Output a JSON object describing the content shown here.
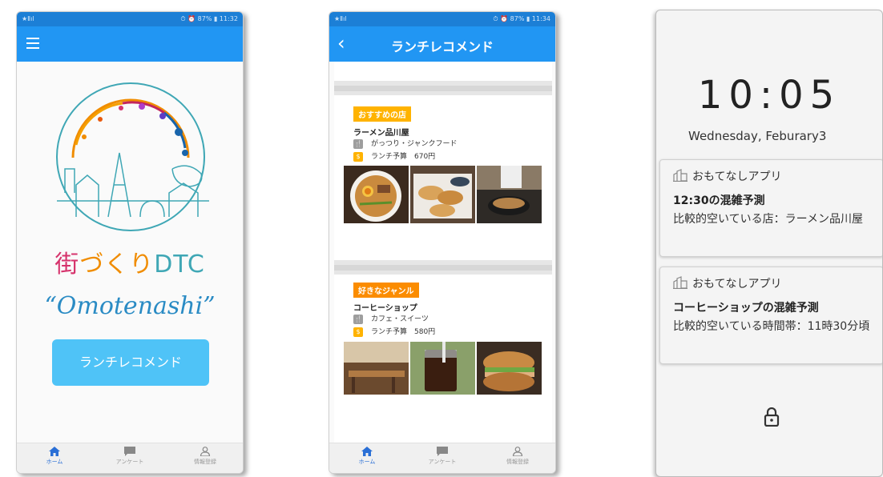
{
  "phone1": {
    "status_left": "★Ⅱıl",
    "status_right": "⏱ ⏰ 87% ▮ 11:32",
    "brand": {
      "part1": "街",
      "part2": "づくり",
      "part3": "DTC"
    },
    "tagline": "“Omotenashi”",
    "main_button": "ランチレコメンド",
    "nav": [
      {
        "label": "ホーム",
        "icon": "home-icon"
      },
      {
        "label": "アンケート",
        "icon": "chat-icon"
      },
      {
        "label": "情報登録",
        "icon": "person-icon"
      }
    ]
  },
  "phone2": {
    "status_left": "★Ⅱıl",
    "status_right": "⏱ ⏰ 87% ▮ 11:34",
    "title": "ランチレコメンド",
    "cards": [
      {
        "badge": "おすすめの店",
        "name": "ラーメン品川屋",
        "genre": "がっつり・ジャンクフード",
        "budget": "ランチ予算　670円"
      },
      {
        "badge": "好きなジャンル",
        "name": "コーヒーショップ",
        "genre": "カフェ・スイーツ",
        "budget": "ランチ予算　580円"
      }
    ],
    "nav": [
      {
        "label": "ホーム"
      },
      {
        "label": "アンケート"
      },
      {
        "label": "情報登録"
      }
    ]
  },
  "phone3": {
    "time": "10:05",
    "date": "Wednesday, Feburary3",
    "notifications": [
      {
        "app": "おもてなしアプリ",
        "title": "12:30の混雑予測",
        "body": "比較的空いている店：ラーメン品川屋"
      },
      {
        "app": "おもてなしアプリ",
        "title": "コーヒーショップの混雑予測",
        "body": "比較的空いている時間帯：11時30分頃"
      }
    ]
  },
  "colors": {
    "primary": "#2196f3",
    "statusbar": "#1c7fd6",
    "button": "#4fc3f7",
    "badge": "#ffb300"
  }
}
